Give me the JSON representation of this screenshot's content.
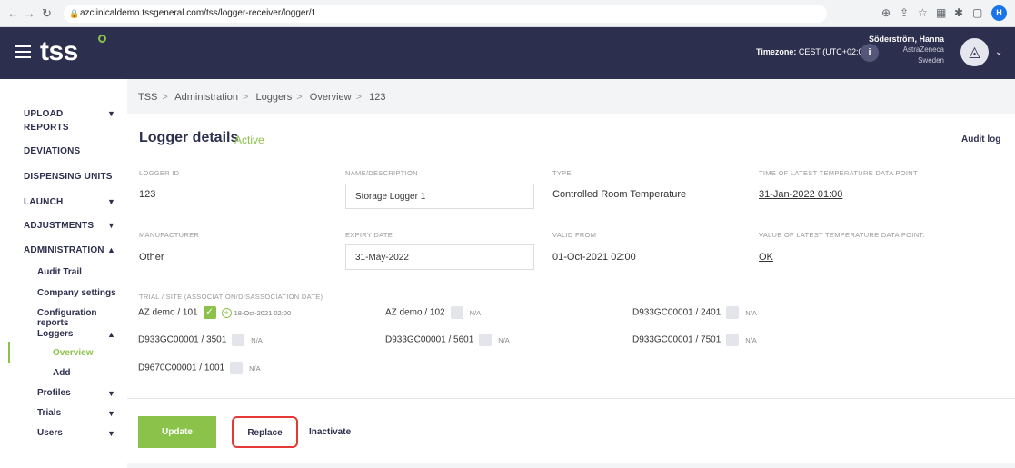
{
  "browser": {
    "url": "azclinicaldemo.tssgeneral.com/tss/logger-receiver/logger/1",
    "profile_initial": "H"
  },
  "header": {
    "logo": "tss",
    "timezone_label": "Timezone:",
    "timezone_value": "CEST (UTC+02:00)",
    "info_glyph": "i",
    "user_name": "Söderström, Hanna",
    "user_company": "AstraZeneca",
    "user_country": "Sweden"
  },
  "sidebar": {
    "upload": "UPLOAD",
    "reports": "REPORTS",
    "deviations": "DEVIATIONS",
    "dispensing_units": "DISPENSING UNITS",
    "launch": "LAUNCH",
    "adjustments": "ADJUSTMENTS",
    "administration": "ADMINISTRATION",
    "audit_trail": "Audit Trail",
    "company_settings": "Company settings",
    "configuration_reports": "Configuration reports",
    "loggers": "Loggers",
    "overview": "Overview",
    "add": "Add",
    "profiles": "Profiles",
    "trials": "Trials",
    "users": "Users"
  },
  "breadcrumb": [
    "TSS",
    "Administration",
    "Loggers",
    "Overview",
    "123"
  ],
  "details": {
    "title": "Logger details",
    "status": "Active",
    "audit_log": "Audit log",
    "logger_id_label": "LOGGER ID",
    "logger_id": "123",
    "name_label": "NAME/DESCRIPTION",
    "name": "Storage Logger 1",
    "type_label": "TYPE",
    "type": "Controlled Room Temperature",
    "latest_time_label": "TIME OF LATEST TEMPERATURE DATA POINT",
    "latest_time": "31-Jan-2022 01:00",
    "manufacturer_label": "MANUFACTURER",
    "manufacturer": "Other",
    "expiry_label": "EXPIRY DATE",
    "expiry": "31-May-2022",
    "valid_from_label": "VALID FROM",
    "valid_from": "01-Oct-2021 02:00",
    "latest_value_label": "VALUE OF LATEST TEMPERATURE DATA POINT.",
    "latest_value": "OK",
    "trial_label": "TRIAL / SITE (ASSOCIATION/DISASSOCIATION DATE)"
  },
  "trials": [
    {
      "name": "AZ demo / 101",
      "checked": true,
      "date": "18-Oct-2021 02:00"
    },
    {
      "name": "AZ demo / 102",
      "status": "N/A"
    },
    {
      "name": "D933GC00001 / 2401",
      "status": "N/A"
    },
    {
      "name": "D933GC00001 / 3501",
      "status": "N/A"
    },
    {
      "name": "D933GC00001 / 5601",
      "status": "N/A"
    },
    {
      "name": "D933GC00001 / 7501",
      "status": "N/A"
    },
    {
      "name": "D9670C00001 / 1001",
      "status": "N/A"
    }
  ],
  "actions": {
    "update": "Update",
    "replace": "Replace",
    "inactivate": "Inactivate"
  },
  "colors": {
    "header_bg": "#2d2f4e",
    "accent_green": "#8bc34a",
    "highlight_red": "#e53935"
  }
}
